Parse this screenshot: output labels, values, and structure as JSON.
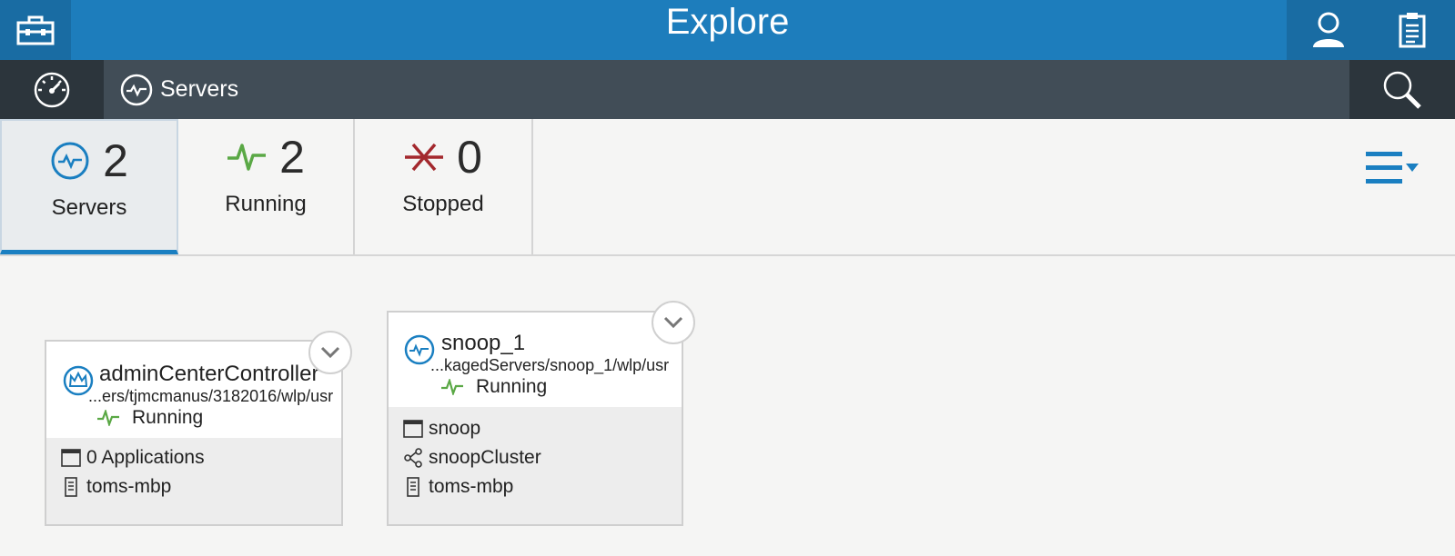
{
  "header": {
    "title": "Explore"
  },
  "nav": {
    "breadcrumb_label": "Servers"
  },
  "summary": {
    "servers": {
      "count": "2",
      "label": "Servers"
    },
    "running": {
      "count": "2",
      "label": "Running"
    },
    "stopped": {
      "count": "0",
      "label": "Stopped"
    }
  },
  "cards": [
    {
      "name": "adminCenterController",
      "path": "...ers/tjmcmanus/3182016/wlp/usr",
      "status": "Running",
      "details": [
        "0 Applications",
        "toms-mbp"
      ]
    },
    {
      "name": "snoop_1",
      "path": "...kagedServers/snoop_1/wlp/usr",
      "status": "Running",
      "details": [
        "snoop",
        "snoopCluster",
        "toms-mbp"
      ]
    }
  ],
  "colors": {
    "header_blue": "#1d7dbc",
    "nav_gray": "#414d57",
    "accent_blue": "#1a7fc1",
    "running_green": "#5aa845",
    "stopped_red": "#a3282d"
  },
  "icons": {
    "toolbox": "toolbox-icon",
    "user": "user-icon",
    "clipboard": "clipboard-icon",
    "dashboard": "dashboard-icon",
    "server": "server-icon",
    "search": "search-icon",
    "running": "pulse-icon",
    "stopped": "x-icon",
    "menu": "list-menu-icon",
    "crown": "crown-icon",
    "application": "application-icon",
    "host": "host-icon",
    "cluster": "cluster-icon",
    "chevron": "chevron-down-icon"
  }
}
